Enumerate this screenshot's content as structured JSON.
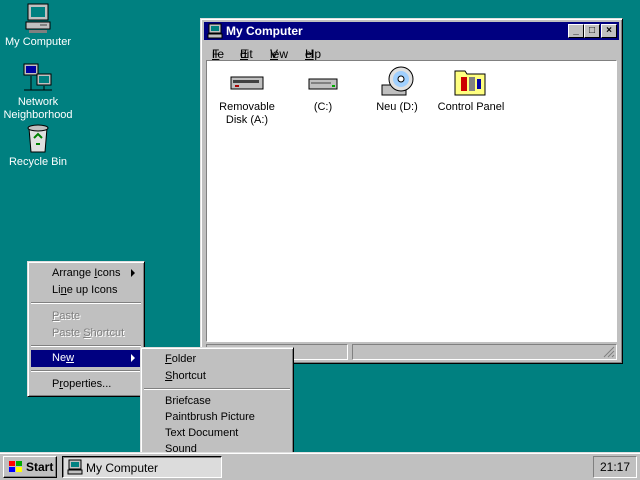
{
  "desktop": {
    "icons": [
      {
        "label": "My Computer",
        "icon": "my-computer-icon"
      },
      {
        "label": "Network Neighborhood",
        "label_line1": "Network",
        "label_line2": "Neighborhood",
        "icon": "network-neighborhood-icon"
      },
      {
        "label": "Recycle Bin",
        "icon": "recycle-bin-icon"
      }
    ]
  },
  "window": {
    "title": "My Computer",
    "controls": {
      "minimize": "_",
      "maximize": "□",
      "close": "×"
    },
    "menu": [
      {
        "label": "File",
        "accel": "F",
        "rest": "ile"
      },
      {
        "label": "Edit",
        "accel": "E",
        "rest": "dit"
      },
      {
        "label": "View",
        "accel": "V",
        "rest": "iew"
      },
      {
        "label": "Help",
        "accel": "H",
        "rest": "elp"
      }
    ],
    "items": [
      {
        "label_line1": "Removable",
        "label_line2": "Disk (A:)",
        "icon": "floppy-drive-icon"
      },
      {
        "label_line1": "(C:)",
        "icon": "hard-drive-icon"
      },
      {
        "label_line1": "Neu (D:)",
        "icon": "cd-drive-icon"
      },
      {
        "label_line1": "Control Panel",
        "icon": "control-panel-icon"
      }
    ]
  },
  "context_menu": {
    "items": [
      {
        "pre": "Arrange ",
        "accel": "I",
        "post": "cons",
        "submenu": true,
        "enabled": true
      },
      {
        "pre": "Li",
        "accel": "n",
        "post": "e up Icons",
        "enabled": true
      },
      {
        "pre": "",
        "accel": "P",
        "post": "aste",
        "enabled": false
      },
      {
        "pre": "Paste ",
        "accel": "S",
        "post": "hortcut",
        "enabled": false
      },
      {
        "pre": "Ne",
        "accel": "w",
        "post": "",
        "submenu": true,
        "enabled": true,
        "selected": true
      },
      {
        "pre": "P",
        "accel": "r",
        "post": "operties...",
        "enabled": true
      }
    ]
  },
  "new_submenu": {
    "items": [
      {
        "pre": "",
        "accel": "F",
        "post": "older"
      },
      {
        "pre": "",
        "accel": "S",
        "post": "hortcut"
      },
      {
        "pre": "Briefcase",
        "accel": "",
        "post": ""
      },
      {
        "pre": "Paintbrush Picture",
        "accel": "",
        "post": ""
      },
      {
        "pre": "Text Document",
        "accel": "",
        "post": ""
      },
      {
        "pre": "Sound",
        "accel": "",
        "post": ""
      }
    ]
  },
  "taskbar": {
    "start_label": "Start",
    "tasks": [
      {
        "label": "My Computer",
        "icon": "my-computer-icon"
      }
    ],
    "clock": "21:17"
  }
}
